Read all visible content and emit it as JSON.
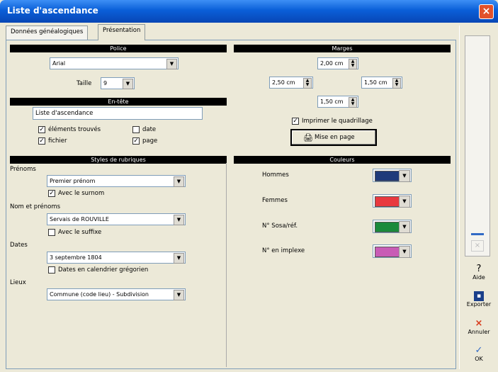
{
  "window": {
    "title": "Liste d'ascendance",
    "close_icon": "close-icon"
  },
  "tabs": [
    {
      "label": "Données généalogiques",
      "active": false
    },
    {
      "label": "Présentation",
      "active": true
    }
  ],
  "police": {
    "header": "Police",
    "font_value": "Arial",
    "size_label": "Taille",
    "size_value": "9"
  },
  "entete": {
    "header": "En-tête",
    "text_value": "Liste d'ascendance",
    "checkboxes": [
      {
        "label": "éléments trouvés",
        "checked": true
      },
      {
        "label": "date",
        "checked": false
      },
      {
        "label": "fichier",
        "checked": true
      },
      {
        "label": "page",
        "checked": true
      }
    ]
  },
  "styles": {
    "header": "Styles de rubriques",
    "prenoms_label": "Prénoms",
    "prenoms_value": "Premier prénom",
    "prenoms_checkbox": "Avec le surnom",
    "nom_label": "Nom et prénoms",
    "nom_value": "Servais de ROUVILLE",
    "nom_checkbox": "Avec le suffixe",
    "dates_label": "Dates",
    "dates_value": "3 septembre 1804",
    "dates_checkbox": "Dates en calendrier grégorien",
    "lieux_label": "Lieux",
    "lieux_value": "Commune (code lieu) - Subdivision"
  },
  "marges": {
    "header": "Marges",
    "top": "2,00 cm",
    "left": "2,50 cm",
    "right": "1,50 cm",
    "bottom": "1,50 cm",
    "quadrillage_label": "Imprimer le quadrillage",
    "mise_en_page_label": "Mise en page"
  },
  "couleurs": {
    "header": "Couleurs",
    "items": [
      {
        "label": "Hommes",
        "color": "#1f3a7a"
      },
      {
        "label": "Femmes",
        "color": "#e8393f"
      },
      {
        "label": "N° Sosa/réf.",
        "color": "#1a8a3c"
      },
      {
        "label": "N° en implexe",
        "color": "#c85bb5"
      }
    ]
  },
  "sidebar": {
    "aide": "Aide",
    "exporter": "Exporter",
    "annuler": "Annuler",
    "ok": "OK"
  }
}
